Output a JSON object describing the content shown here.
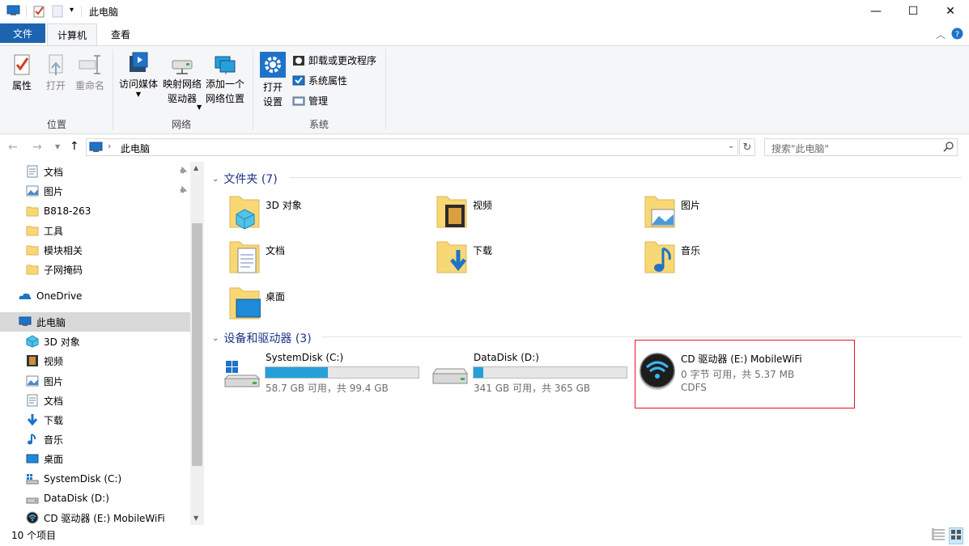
{
  "window": {
    "title": "此电脑",
    "minimize": "—",
    "maximize": "☐",
    "close": "✕"
  },
  "ribbon_tabs": {
    "file": "文件",
    "computer": "计算机",
    "view": "查看"
  },
  "ribbon": {
    "location_group": "位置",
    "network_group": "网络",
    "system_group": "系统",
    "properties": "属性",
    "open": "打开",
    "rename": "重命名",
    "access_media": "访问媒体",
    "map_drive_1": "映射网络",
    "map_drive_2": "驱动器",
    "add_location_1": "添加一个",
    "add_location_2": "网络位置",
    "open_settings_1": "打开",
    "open_settings_2": "设置",
    "uninstall": "卸载或更改程序",
    "sys_props": "系统属性",
    "manage": "管理"
  },
  "address": {
    "path": "此电脑",
    "search_placeholder": "搜索\"此电脑\""
  },
  "nav": {
    "quick": [
      {
        "label": "文档",
        "pinned": true
      },
      {
        "label": "图片",
        "pinned": true
      },
      {
        "label": "B818-263",
        "pinned": false
      },
      {
        "label": "工具",
        "pinned": false
      },
      {
        "label": "模块相关",
        "pinned": false
      },
      {
        "label": "子网掩码",
        "pinned": false
      }
    ],
    "onedrive": "OneDrive",
    "thispc": "此电脑",
    "pc_items": [
      "3D 对象",
      "视频",
      "图片",
      "文档",
      "下载",
      "音乐",
      "桌面",
      "SystemDisk (C:)",
      "DataDisk (D:)",
      "CD 驱动器 (E:) MobileWiFi"
    ]
  },
  "folders_section": {
    "header": "文件夹 (7)",
    "items": [
      "3D 对象",
      "视频",
      "图片",
      "文档",
      "下载",
      "音乐",
      "桌面"
    ]
  },
  "drives_section": {
    "header": "设备和驱动器 (3)",
    "c_name": "SystemDisk (C:)",
    "c_info": "58.7 GB 可用，共 99.4 GB",
    "c_used_fraction": 0.41,
    "d_name": "DataDisk (D:)",
    "d_info": "341 GB 可用，共 365 GB",
    "d_used_fraction": 0.066,
    "e_name": "CD 驱动器 (E:) MobileWiFi",
    "e_info": "0 字节 可用，共 5.37 MB",
    "e_fs": "CDFS"
  },
  "status": {
    "count": "10 个项目"
  },
  "colors": {
    "accent": "#1e63b0",
    "drive_bar": "#26a0da",
    "highlight": "#e81123",
    "folder": "#f8d775"
  }
}
